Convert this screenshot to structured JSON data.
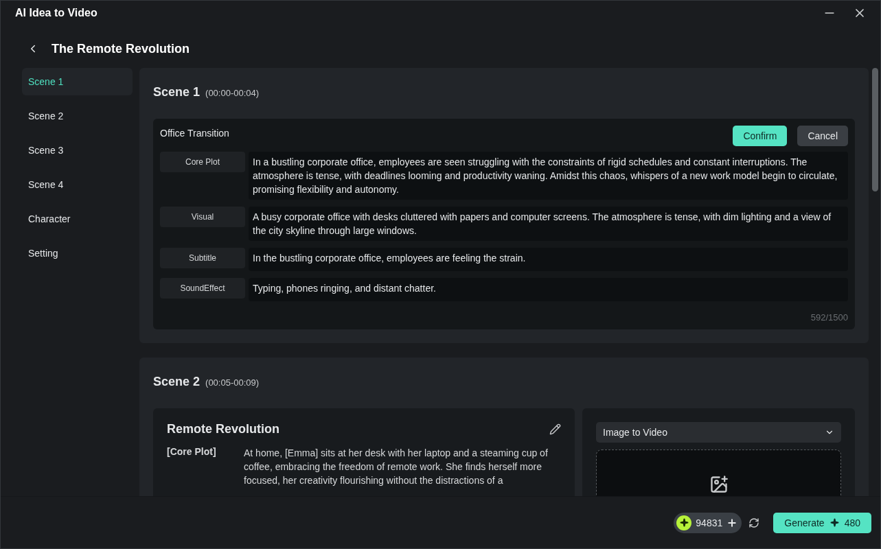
{
  "window": {
    "title": "AI Idea to Video"
  },
  "header": {
    "title": "The Remote Revolution"
  },
  "sidebar": {
    "items": [
      {
        "label": "Scene 1",
        "selected": true
      },
      {
        "label": "Scene 2",
        "selected": false
      },
      {
        "label": "Scene 3",
        "selected": false
      },
      {
        "label": "Scene 4",
        "selected": false
      },
      {
        "label": "Character",
        "selected": false
      },
      {
        "label": "Setting",
        "selected": false
      }
    ]
  },
  "scenes": [
    {
      "kind": "editing",
      "title": "Scene 1",
      "time": "(00:00-00:04)",
      "editor": {
        "title": "Office Transition",
        "confirm": "Confirm",
        "cancel": "Cancel",
        "counter": "592/1500",
        "fields": [
          {
            "label": "Core Plot",
            "value": "In a bustling corporate office, employees are seen struggling with the constraints of rigid schedules and constant interruptions. The atmosphere is tense, with deadlines looming and productivity waning. Amidst this chaos, whispers of a new work model begin to circulate, promising flexibility and autonomy."
          },
          {
            "label": "Visual",
            "value": "A busy corporate office with desks cluttered with papers and computer screens. The atmosphere is tense, with dim lighting and a view of the city skyline through large windows."
          },
          {
            "label": "Subtitle",
            "value": "In the bustling corporate office, employees are feeling the strain."
          },
          {
            "label": "SoundEffect",
            "value": "Typing, phones ringing, and distant chatter."
          }
        ]
      }
    },
    {
      "kind": "preview",
      "title": "Scene 2",
      "time": "(00:05-00:09)",
      "summary": {
        "title": "Remote Revolution",
        "rows": [
          {
            "label": "[Core Plot]",
            "text": "At home, [Emma] sits at her desk with her laptop and a steaming cup of coffee, embracing the freedom of remote work. She finds herself more focused, her creativity flourishing without the distractions of a"
          }
        ]
      },
      "mode": {
        "value": "Image to Video"
      }
    }
  ],
  "footer": {
    "credits": "94831",
    "generate": "Generate",
    "cost": "480"
  }
}
